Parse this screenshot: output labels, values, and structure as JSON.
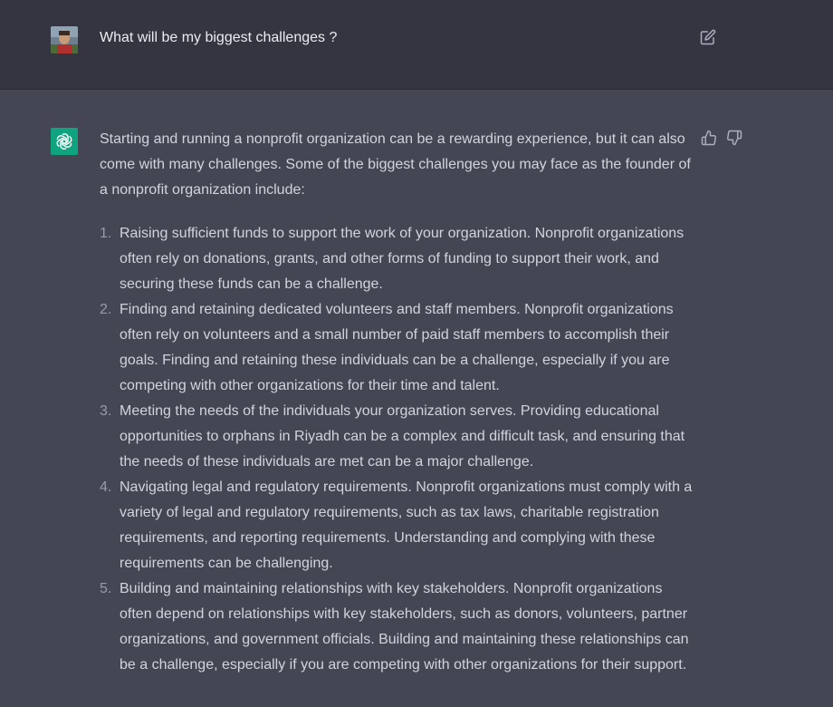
{
  "user_message": {
    "text": "What will be my biggest challenges ?"
  },
  "assistant_message": {
    "intro": "Starting and running a nonprofit organization can be a rewarding experience, but it can also come with many challenges. Some of the biggest challenges you may face as the founder of a nonprofit organization include:",
    "items": [
      {
        "number": "1.",
        "text": "Raising sufficient funds to support the work of your organization. Nonprofit organizations often rely on donations, grants, and other forms of funding to support their work, and securing these funds can be a challenge."
      },
      {
        "number": "2.",
        "text": "Finding and retaining dedicated volunteers and staff members. Nonprofit organizations often rely on volunteers and a small number of paid staff members to accomplish their goals. Finding and retaining these individuals can be a challenge, especially if you are competing with other organizations for their time and talent."
      },
      {
        "number": "3.",
        "text": "Meeting the needs of the individuals your organization serves. Providing educational opportunities to orphans in Riyadh can be a complex and difficult task, and ensuring that the needs of these individuals are met can be a major challenge."
      },
      {
        "number": "4.",
        "text": "Navigating legal and regulatory requirements. Nonprofit organizations must comply with a variety of legal and regulatory requirements, such as tax laws, charitable registration requirements, and reporting requirements. Understanding and complying with these requirements can be challenging."
      },
      {
        "number": "5.",
        "text": "Building and maintaining relationships with key stakeholders. Nonprofit organizations often depend on relationships with key stakeholders, such as donors, volunteers, partner organizations, and government officials. Building and maintaining these relationships can be a challenge, especially if you are competing with other organizations for their support."
      }
    ]
  },
  "icons": {
    "user_avatar": "user-avatar-photo",
    "edit": "edit-icon",
    "assistant_avatar": "openai-logo-icon",
    "thumbs_up": "thumbs-up-icon",
    "thumbs_down": "thumbs-down-icon"
  },
  "colors": {
    "user_bg": "#343541",
    "assistant_bg": "#444654",
    "accent": "#10a37f",
    "text": "#d1d5db"
  }
}
